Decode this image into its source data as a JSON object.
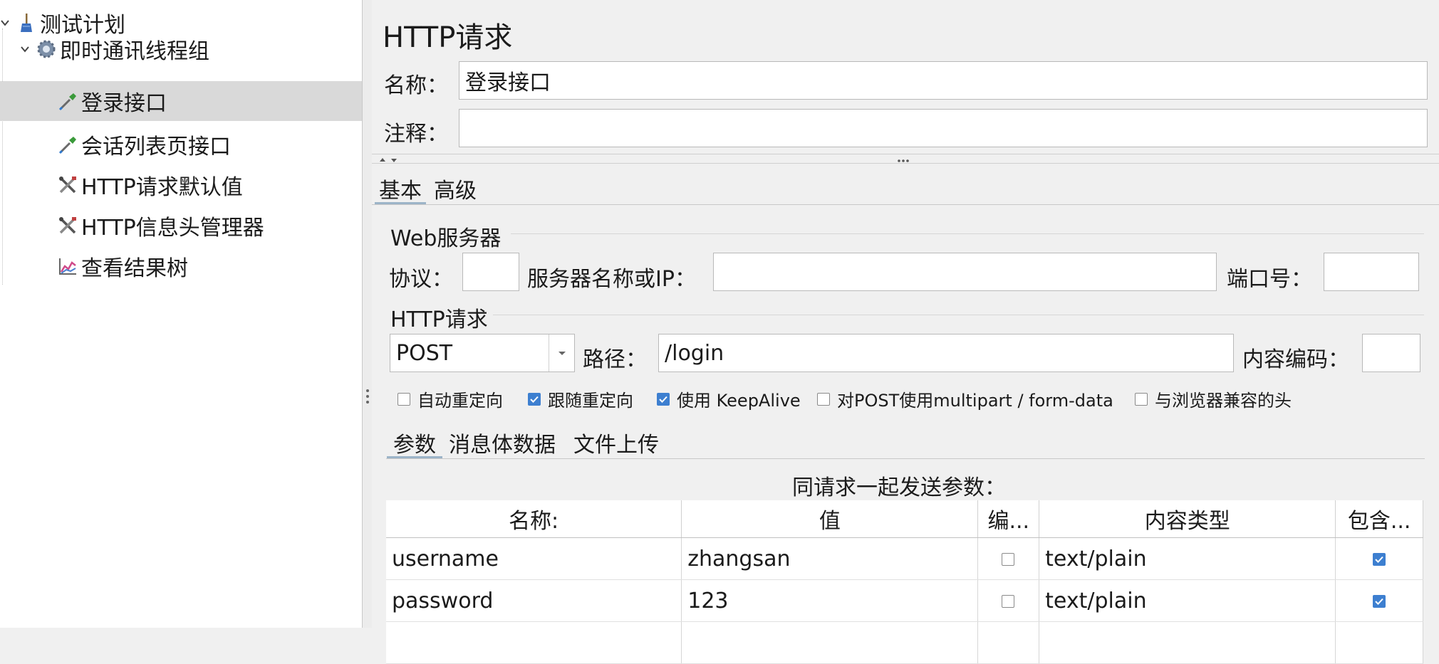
{
  "tree": {
    "items": [
      {
        "label": "测试计划",
        "icon": "broom-icon",
        "expanded": true
      },
      {
        "label": "即时通讯线程组",
        "icon": "gear-icon",
        "expanded": true
      },
      {
        "label": "登录接口",
        "icon": "pipette-icon",
        "selected": true
      },
      {
        "label": "会话列表页接口",
        "icon": "pipette-icon"
      },
      {
        "label": "HTTP请求默认值",
        "icon": "wrench-screwdriver-icon"
      },
      {
        "label": "HTTP信息头管理器",
        "icon": "wrench-screwdriver-icon"
      },
      {
        "label": "查看结果树",
        "icon": "chart-icon"
      }
    ]
  },
  "panel": {
    "title": "HTTP请求",
    "name_label": "名称：",
    "name_value": "登录接口",
    "comment_label": "注释：",
    "comment_value": "",
    "tabs": [
      {
        "label": "基本",
        "selected": true
      },
      {
        "label": "高级"
      }
    ],
    "web_server": {
      "title": "Web服务器",
      "protocol_label": "协议：",
      "protocol_value": "",
      "server_label": "服务器名称或IP：",
      "server_value": "",
      "port_label": "端口号：",
      "port_value": ""
    },
    "http_request": {
      "title": "HTTP请求",
      "method": "POST",
      "path_label": "路径：",
      "path_value": "/login",
      "encoding_label": "内容编码：",
      "encoding_value": ""
    },
    "options": [
      {
        "label": "自动重定向",
        "checked": false
      },
      {
        "label": "跟随重定向",
        "checked": true
      },
      {
        "label": "使用 KeepAlive",
        "checked": true
      },
      {
        "label": "对POST使用multipart / form-data",
        "checked": false
      },
      {
        "label": "与浏览器兼容的头",
        "checked": false
      }
    ],
    "sub_tabs": [
      {
        "label": "参数",
        "selected": true
      },
      {
        "label": "消息体数据"
      },
      {
        "label": "文件上传"
      }
    ],
    "params_caption": "同请求一起发送参数：",
    "params_table": {
      "headers": [
        "名称:",
        "值",
        "编...",
        "内容类型",
        "包含..."
      ],
      "rows": [
        {
          "name": "username",
          "value": "zhangsan",
          "encode": false,
          "content_type": "text/plain",
          "include_equals": true
        },
        {
          "name": "password",
          "value": "123",
          "encode": false,
          "content_type": "text/plain",
          "include_equals": true
        }
      ]
    }
  },
  "colors": {
    "selection": "#d9d9d9",
    "checkbox_checked": "#3d7fd0",
    "tab_underline": "#9cb4c8"
  }
}
